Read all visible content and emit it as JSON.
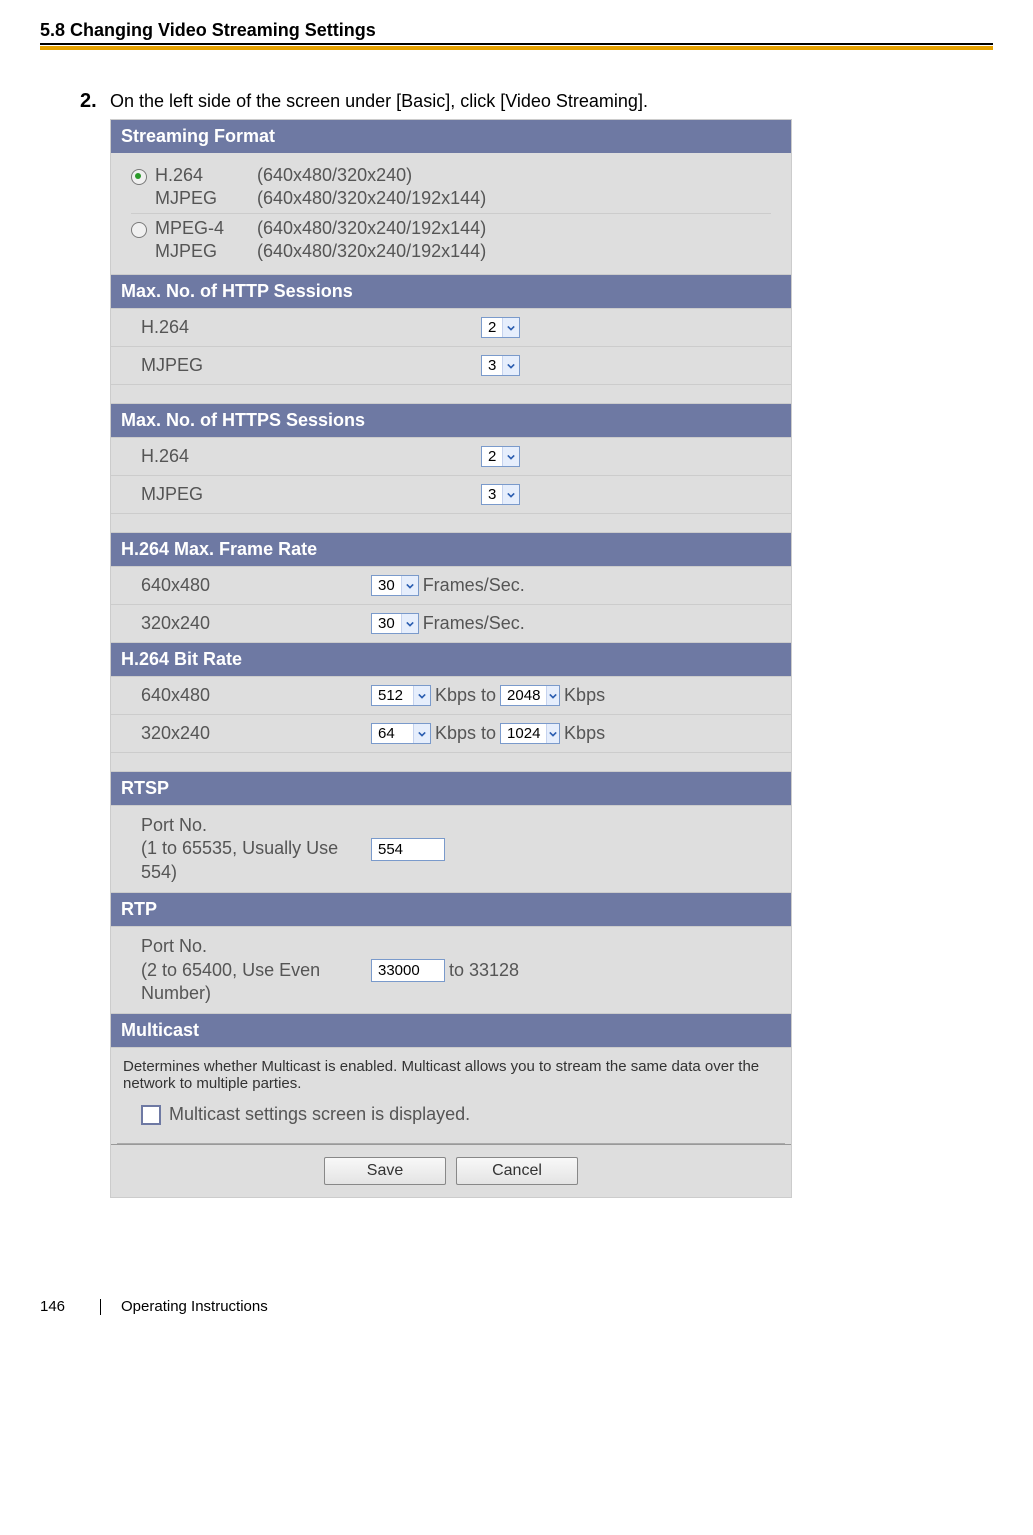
{
  "header": {
    "section_title": "5.8 Changing Video Streaming Settings"
  },
  "step": {
    "num": "2.",
    "text": "On the left side of the screen under [Basic], click [Video Streaming]."
  },
  "streaming_format": {
    "title": "Streaming Format",
    "opt1": {
      "line1_a": "H.264",
      "line1_b": "(640x480/320x240)",
      "line2_a": "MJPEG",
      "line2_b": "(640x480/320x240/192x144)"
    },
    "opt2": {
      "line1_a": "MPEG-4",
      "line1_b": "(640x480/320x240/192x144)",
      "line2_a": "MJPEG",
      "line2_b": "(640x480/320x240/192x144)"
    }
  },
  "http_sessions": {
    "title": "Max. No. of HTTP Sessions",
    "row1_label": "H.264",
    "row1_value": "2",
    "row2_label": "MJPEG",
    "row2_value": "3"
  },
  "https_sessions": {
    "title": "Max. No. of HTTPS Sessions",
    "row1_label": "H.264",
    "row1_value": "2",
    "row2_label": "MJPEG",
    "row2_value": "3"
  },
  "frame_rate": {
    "title": "H.264 Max. Frame Rate",
    "row1_label": "640x480",
    "row1_value": "30",
    "unit": "Frames/Sec.",
    "row2_label": "320x240",
    "row2_value": "30"
  },
  "bit_rate": {
    "title": "H.264 Bit Rate",
    "row1_label": "640x480",
    "row1_from": "512",
    "row1_to": "2048",
    "row2_label": "320x240",
    "row2_from": "64",
    "row2_to": "1024",
    "unit": "Kbps",
    "to_text": "Kbps to"
  },
  "rtsp": {
    "title": "RTSP",
    "label": "Port No.\n(1 to 65535, Usually Use 554)",
    "value": "554"
  },
  "rtp": {
    "title": "RTP",
    "label": "Port No.\n(2 to 65400, Use Even Number)",
    "value": "33000",
    "suffix": "to 33128"
  },
  "multicast": {
    "title": "Multicast",
    "desc": "Determines whether Multicast is enabled. Multicast allows you to stream the same data over the network to multiple parties.",
    "chk_label": "Multicast settings screen is displayed."
  },
  "buttons": {
    "save": "Save",
    "cancel": "Cancel"
  },
  "footer": {
    "page": "146",
    "doc": "Operating Instructions"
  }
}
